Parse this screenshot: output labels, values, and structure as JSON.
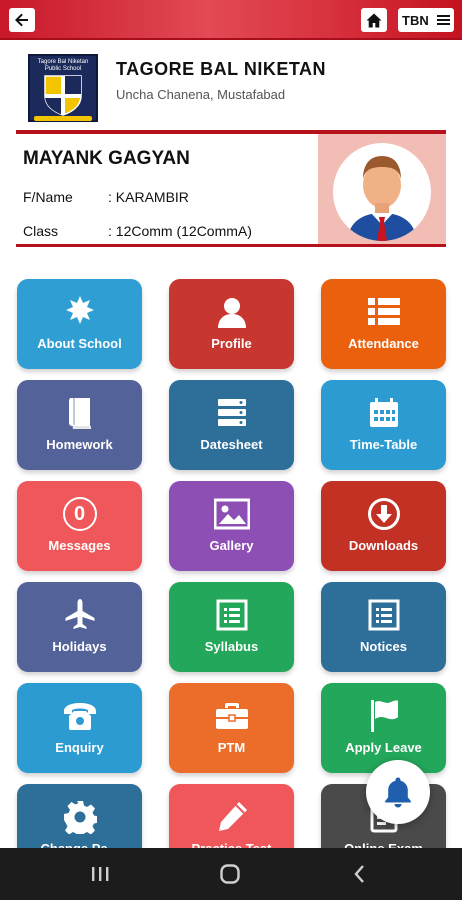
{
  "topbar": {
    "back_icon": "arrow-left-icon",
    "home_icon": "home-icon",
    "menu_label": "TBN",
    "menu_icon": "hamburger-icon"
  },
  "school": {
    "logo_text": "Tagore Bal Niketan Public School",
    "name": "TAGORE BAL NIKETAN",
    "address": "Uncha Chanena, Mustafabad"
  },
  "student": {
    "name": "MAYANK GAGYAN",
    "father_label": "F/Name",
    "father_value": ": KARAMBIR",
    "class_label": "Class",
    "class_value": ": 12Comm (12CommA)"
  },
  "tiles": [
    {
      "label": "About School",
      "icon": "sunburst-icon",
      "color": "#2f9fd3"
    },
    {
      "label": "Profile",
      "icon": "user-icon",
      "color": "#c7362f"
    },
    {
      "label": "Attendance",
      "icon": "list-icon",
      "color": "#ea600c"
    },
    {
      "label": "Homework",
      "icon": "book-icon",
      "color": "#54629a"
    },
    {
      "label": "Datesheet",
      "icon": "server-icon",
      "color": "#2e6f9a"
    },
    {
      "label": "Time-Table",
      "icon": "calendar-icon",
      "color": "#2b9bd1"
    },
    {
      "label": "Messages",
      "icon": "zero-count-icon",
      "color": "#f0575a"
    },
    {
      "label": "Gallery",
      "icon": "image-icon",
      "color": "#8e4fb5"
    },
    {
      "label": "Downloads",
      "icon": "download-icon",
      "color": "#c33024"
    },
    {
      "label": "Holidays",
      "icon": "airplane-icon",
      "color": "#54629a"
    },
    {
      "label": "Syllabus",
      "icon": "syllabus-list-icon",
      "color": "#23a75a"
    },
    {
      "label": "Notices",
      "icon": "notice-list-icon",
      "color": "#2e6f9a"
    },
    {
      "label": "Enquiry",
      "icon": "phone-icon",
      "color": "#2b9bd1"
    },
    {
      "label": "PTM",
      "icon": "briefcase-icon",
      "color": "#ec6d2a"
    },
    {
      "label": "Apply Leave",
      "icon": "flag-icon",
      "color": "#23a75a"
    },
    {
      "label": "Change Pa...",
      "icon": "gear-icon",
      "color": "#2e6f9a"
    },
    {
      "label": "Practice Test",
      "icon": "pencil-icon",
      "color": "#f0575a"
    },
    {
      "label": "Online Exam",
      "icon": "exam-icon",
      "color": "#4a4a4a"
    }
  ],
  "messages_count": "0",
  "fab_icon": "bell-icon",
  "navbar": {
    "recents_icon": "recents-icon",
    "home_icon": "nav-home-icon",
    "back_icon": "nav-back-icon"
  },
  "colors": {
    "topbar": "#d3222e",
    "accent_border": "#b5121b",
    "photo_bg": "#f2bdb4",
    "navbar": "#1c1c1c"
  }
}
